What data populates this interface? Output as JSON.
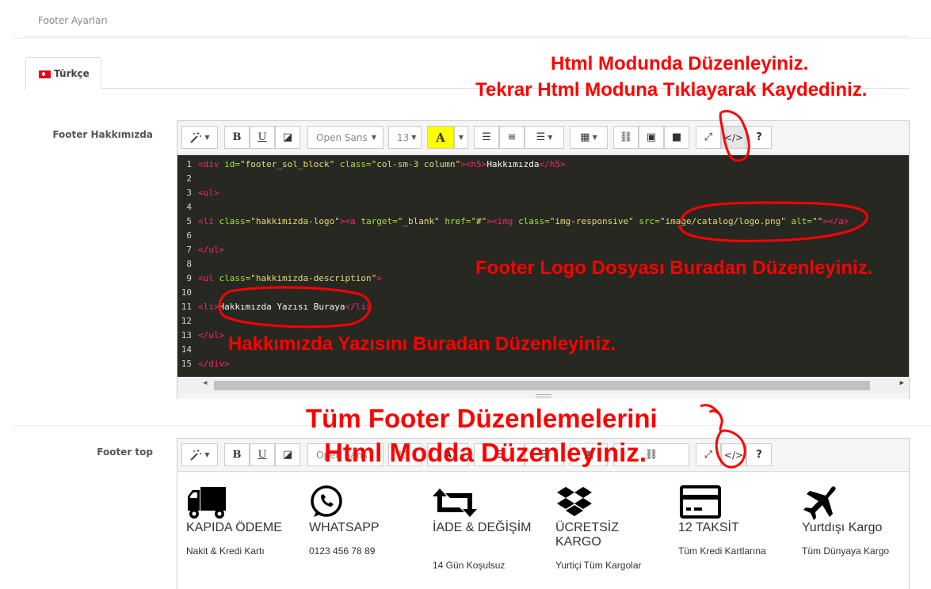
{
  "header": {
    "title": "Footer Ayarları"
  },
  "language_tab": {
    "label": "Türkçe"
  },
  "fields": {
    "footer_about_label": "Footer Hakkımızda",
    "footer_top_label": "Footer top"
  },
  "toolbar": {
    "font_name": "Open Sans",
    "font_size": "13",
    "code_view": "</>",
    "help": "?"
  },
  "code_lines": [
    {
      "n": "1"
    },
    {
      "n": "2"
    },
    {
      "n": "3"
    },
    {
      "n": "4"
    },
    {
      "n": "5"
    },
    {
      "n": "6"
    },
    {
      "n": "7"
    },
    {
      "n": "8"
    },
    {
      "n": "9"
    },
    {
      "n": "10"
    },
    {
      "n": "11"
    },
    {
      "n": "12"
    },
    {
      "n": "13"
    },
    {
      "n": "14"
    },
    {
      "n": "15"
    }
  ],
  "code": {
    "l1": [
      "<div ",
      "id=",
      "\"footer_sol_block\" ",
      "class=",
      "\"col-sm-3 column\"",
      "><h5>",
      "Hakkımızda",
      "</h5>"
    ],
    "l3": "<ul>",
    "l5": [
      "<li ",
      "class=",
      "\"hakkimizda-logo\"",
      "><a ",
      "target=",
      "\"_blank\" ",
      "href=",
      "\"#\"",
      "><img ",
      "class=",
      "\"img-responsive\" ",
      "src=",
      "\"image/catalog/logo.png\" ",
      "alt=",
      "\"\"",
      "></a>"
    ],
    "l7": "</ul>",
    "l9": [
      "<ul ",
      "class=",
      "\"hakkimizda-description\"",
      ">"
    ],
    "l11": [
      "<li>",
      "Hakkımızda Yazısı Buraya",
      "</li>"
    ],
    "l13": "</ul>",
    "l15": "</div>"
  },
  "features": [
    {
      "title": "KAPIDA ÖDEME",
      "subtitle": "Nakit & Kredi Kartı",
      "icon": "truck-icon"
    },
    {
      "title": "WHATSAPP",
      "subtitle": "0123 456 78 89",
      "icon": "whatsapp-icon"
    },
    {
      "title": "İADE & DEĞİŞİM",
      "subtitle": "14 Gün Koşulsuz",
      "icon": "retweet-icon"
    },
    {
      "title": "ÜCRETSİZ KARGO",
      "subtitle": "Yurtiçi Tüm Kargolar",
      "icon": "dropbox-icon"
    },
    {
      "title": "12 TAKSİT",
      "subtitle": "Tüm Kredi Kartlarına",
      "icon": "credit-card-icon"
    },
    {
      "title": "Yurtdışı Kargo",
      "subtitle": "Tüm Dünyaya Kargo",
      "icon": "plane-icon"
    }
  ],
  "annotations": {
    "html_mode_line1": "Html Modunda Düzenleyiniz.",
    "html_mode_line2": "Tekrar Html Moduna Tıklayarak Kaydediniz.",
    "logo_note": "Footer Logo Dosyası Buradan Düzenleyiniz.",
    "about_note": "Hakkımızda Yazısını Buradan Düzenleyiniz.",
    "all_footer_line1": "Tüm Footer Düzenlemelerini",
    "all_footer_line2": "Html Modda Düzenleyiniz."
  },
  "colors": {
    "annotation": "#ff0000",
    "code_bg": "#272822",
    "tag": "#f92672",
    "attr": "#a6e22e",
    "string": "#e6db74"
  }
}
